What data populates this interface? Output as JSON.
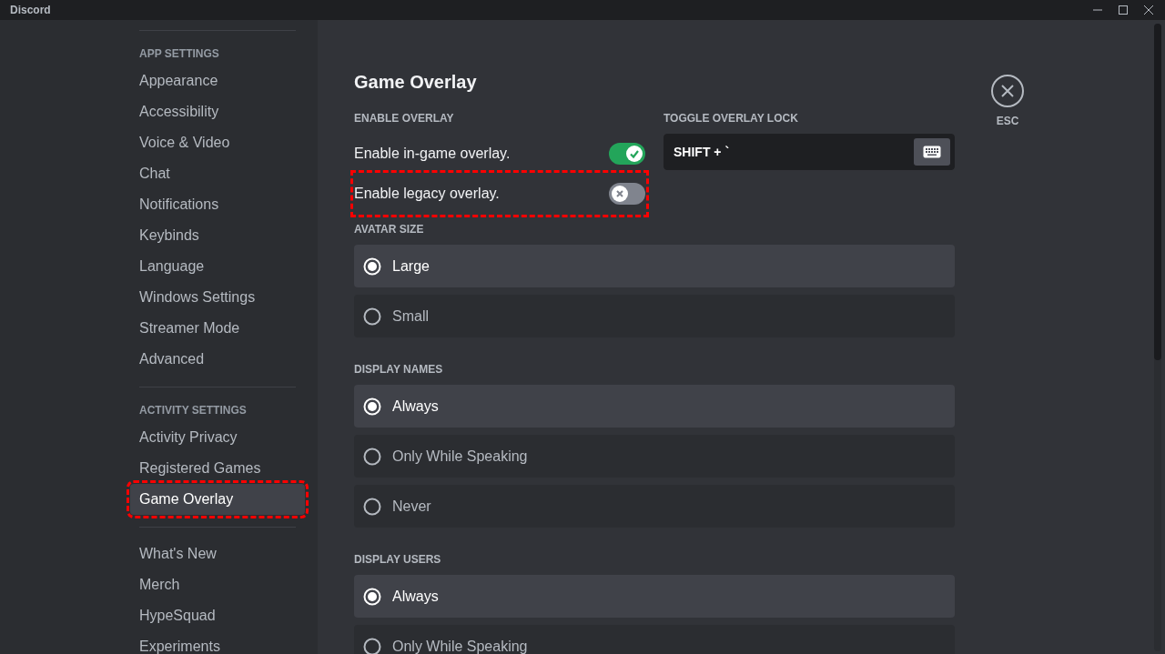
{
  "window": {
    "title": "Discord"
  },
  "sidebar": {
    "sections": [
      {
        "header": "APP SETTINGS",
        "items": [
          {
            "label": "Appearance",
            "selected": false,
            "highlighted": false
          },
          {
            "label": "Accessibility",
            "selected": false,
            "highlighted": false
          },
          {
            "label": "Voice & Video",
            "selected": false,
            "highlighted": false
          },
          {
            "label": "Chat",
            "selected": false,
            "highlighted": false
          },
          {
            "label": "Notifications",
            "selected": false,
            "highlighted": false
          },
          {
            "label": "Keybinds",
            "selected": false,
            "highlighted": false
          },
          {
            "label": "Language",
            "selected": false,
            "highlighted": false
          },
          {
            "label": "Windows Settings",
            "selected": false,
            "highlighted": false
          },
          {
            "label": "Streamer Mode",
            "selected": false,
            "highlighted": false
          },
          {
            "label": "Advanced",
            "selected": false,
            "highlighted": false
          }
        ]
      },
      {
        "header": "ACTIVITY SETTINGS",
        "items": [
          {
            "label": "Activity Privacy",
            "selected": false,
            "highlighted": false
          },
          {
            "label": "Registered Games",
            "selected": false,
            "highlighted": false
          },
          {
            "label": "Game Overlay",
            "selected": true,
            "highlighted": true
          }
        ]
      },
      {
        "items": [
          {
            "label": "What's New",
            "selected": false,
            "highlighted": false
          },
          {
            "label": "Merch",
            "selected": false,
            "highlighted": false
          },
          {
            "label": "HypeSquad",
            "selected": false,
            "highlighted": false
          },
          {
            "label": "Experiments",
            "selected": false,
            "highlighted": false
          }
        ]
      }
    ]
  },
  "page": {
    "title": "Game Overlay",
    "close_label": "ESC",
    "enable_overlay": {
      "header": "ENABLE OVERLAY",
      "toggles": [
        {
          "label": "Enable in-game overlay.",
          "on": true,
          "highlighted": false
        },
        {
          "label": "Enable legacy overlay.",
          "on": false,
          "highlighted": true
        }
      ]
    },
    "overlay_lock": {
      "header": "TOGGLE OVERLAY LOCK",
      "value": "SHIFT + `"
    },
    "radio_groups": [
      {
        "header": "AVATAR SIZE",
        "options": [
          {
            "label": "Large",
            "selected": true
          },
          {
            "label": "Small",
            "selected": false
          }
        ]
      },
      {
        "header": "DISPLAY NAMES",
        "options": [
          {
            "label": "Always",
            "selected": true
          },
          {
            "label": "Only While Speaking",
            "selected": false
          },
          {
            "label": "Never",
            "selected": false
          }
        ]
      },
      {
        "header": "DISPLAY USERS",
        "options": [
          {
            "label": "Always",
            "selected": true
          },
          {
            "label": "Only While Speaking",
            "selected": false
          }
        ]
      }
    ]
  }
}
